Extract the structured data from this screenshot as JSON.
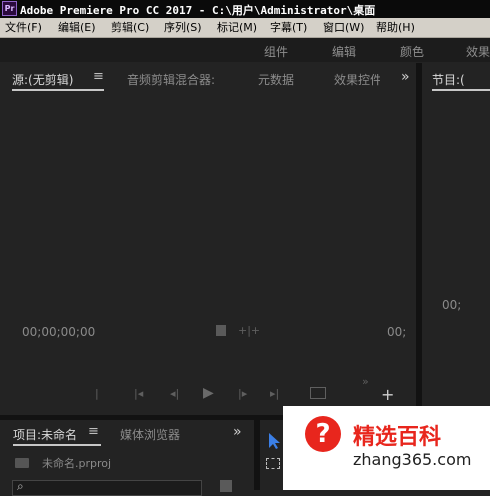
{
  "window": {
    "title": "Adobe Premiere Pro CC 2017 - C:\\用户\\Administrator\\桌面",
    "app_icon_text": "Pr"
  },
  "menu": [
    "文件(F)",
    "编辑(E)",
    "剪辑(C)",
    "序列(S)",
    "标记(M)",
    "字幕(T)",
    "窗口(W)",
    "帮助(H)"
  ],
  "workspaces": [
    "组件",
    "编辑",
    "颜色",
    "效果"
  ],
  "source_panel": {
    "tabs": [
      "源:(无剪辑)",
      "音频剪辑混合器:",
      "元数据",
      "效果控件"
    ],
    "timecode_left": "00;00;00;00",
    "timecode_right": "00;",
    "more": "»"
  },
  "program_panel": {
    "tab": "节目:(",
    "timecode": "00;"
  },
  "project_panel": {
    "tabs": [
      "项目:未命名",
      "媒体浏览器"
    ],
    "file": "未命名.prproj",
    "more": "»"
  },
  "watermark": {
    "brand": "精选百科",
    "url": "zhang365.com"
  },
  "colors": {
    "title_bg": "#0a0a0a",
    "menu_bg": "#d4d0c8",
    "panel_bg": "#232323",
    "tool_blue": "#3b7fe6",
    "watermark_red": "#e8261d"
  }
}
